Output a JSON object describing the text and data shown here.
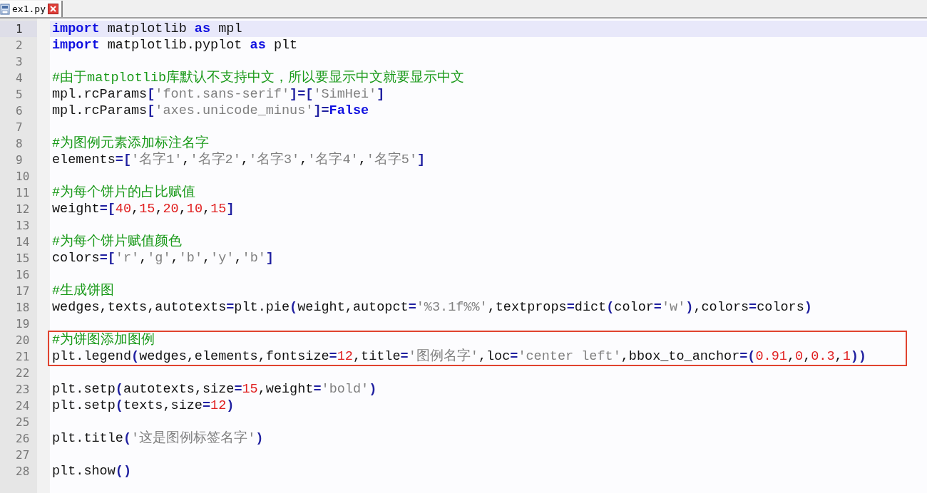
{
  "tabs": [
    {
      "label": "ex1.py",
      "selected": true
    }
  ],
  "lines": [
    {
      "kind": "line",
      "number": "1",
      "current": true,
      "tokens": [
        {
          "kind": "kw",
          "text": "import"
        },
        {
          "kind": "id",
          "text": " matplotlib "
        },
        {
          "kind": "kw",
          "text": "as"
        },
        {
          "kind": "id",
          "text": " mpl"
        }
      ]
    },
    {
      "kind": "line",
      "number": "2",
      "current": false,
      "tokens": [
        {
          "kind": "kw",
          "text": "import"
        },
        {
          "kind": "id",
          "text": " matplotlib.pyplot "
        },
        {
          "kind": "kw",
          "text": "as"
        },
        {
          "kind": "id",
          "text": " plt"
        }
      ]
    },
    {
      "kind": "line",
      "number": "3",
      "current": false
    },
    {
      "kind": "line",
      "number": "4",
      "current": false,
      "tokens": [
        {
          "kind": "com",
          "text": "#由于matplotlib库默认不支持中文，所以要显示中文就要显示中文"
        }
      ]
    },
    {
      "kind": "line",
      "number": "5",
      "current": false,
      "tokens": [
        {
          "kind": "id",
          "text": "mpl.rcParams"
        },
        {
          "kind": "op",
          "text": "["
        },
        {
          "kind": "str",
          "text": "'font.sans-serif'"
        },
        {
          "kind": "op",
          "text": "]=["
        },
        {
          "kind": "str",
          "text": "'SimHei'"
        },
        {
          "kind": "op",
          "text": "]"
        }
      ]
    },
    {
      "kind": "line",
      "number": "6",
      "current": false,
      "tokens": [
        {
          "kind": "id",
          "text": "mpl.rcParams"
        },
        {
          "kind": "op",
          "text": "["
        },
        {
          "kind": "str",
          "text": "'axes.unicode_minus'"
        },
        {
          "kind": "op",
          "text": "]="
        },
        {
          "kind": "kw",
          "text": "False"
        }
      ]
    },
    {
      "kind": "line",
      "number": "7",
      "current": false
    },
    {
      "kind": "line",
      "number": "8",
      "current": false,
      "tokens": [
        {
          "kind": "com",
          "text": "#为图例元素添加标注名字"
        }
      ]
    },
    {
      "kind": "line",
      "number": "9",
      "current": false,
      "tokens": [
        {
          "kind": "id",
          "text": "elements"
        },
        {
          "kind": "op",
          "text": "=["
        },
        {
          "kind": "str",
          "text": "'名字1'"
        },
        {
          "kind": "id",
          "text": ","
        },
        {
          "kind": "str",
          "text": "'名字2'"
        },
        {
          "kind": "id",
          "text": ","
        },
        {
          "kind": "str",
          "text": "'名字3'"
        },
        {
          "kind": "id",
          "text": ","
        },
        {
          "kind": "str",
          "text": "'名字4'"
        },
        {
          "kind": "id",
          "text": ","
        },
        {
          "kind": "str",
          "text": "'名字5'"
        },
        {
          "kind": "op",
          "text": "]"
        }
      ]
    },
    {
      "kind": "line",
      "number": "10",
      "current": false
    },
    {
      "kind": "line",
      "number": "11",
      "current": false,
      "tokens": [
        {
          "kind": "com",
          "text": "#为每个饼片的占比赋值"
        }
      ]
    },
    {
      "kind": "line",
      "number": "12",
      "current": false,
      "tokens": [
        {
          "kind": "id",
          "text": "weight"
        },
        {
          "kind": "op",
          "text": "=["
        },
        {
          "kind": "num",
          "text": "40"
        },
        {
          "kind": "id",
          "text": ","
        },
        {
          "kind": "num",
          "text": "15"
        },
        {
          "kind": "id",
          "text": ","
        },
        {
          "kind": "num",
          "text": "20"
        },
        {
          "kind": "id",
          "text": ","
        },
        {
          "kind": "num",
          "text": "10"
        },
        {
          "kind": "id",
          "text": ","
        },
        {
          "kind": "num",
          "text": "15"
        },
        {
          "kind": "op",
          "text": "]"
        }
      ]
    },
    {
      "kind": "line",
      "number": "13",
      "current": false
    },
    {
      "kind": "line",
      "number": "14",
      "current": false,
      "tokens": [
        {
          "kind": "com",
          "text": "#为每个饼片赋值颜色"
        }
      ]
    },
    {
      "kind": "line",
      "number": "15",
      "current": false,
      "tokens": [
        {
          "kind": "id",
          "text": "colors"
        },
        {
          "kind": "op",
          "text": "=["
        },
        {
          "kind": "str",
          "text": "'r'"
        },
        {
          "kind": "id",
          "text": ","
        },
        {
          "kind": "str",
          "text": "'g'"
        },
        {
          "kind": "id",
          "text": ","
        },
        {
          "kind": "str",
          "text": "'b'"
        },
        {
          "kind": "id",
          "text": ","
        },
        {
          "kind": "str",
          "text": "'y'"
        },
        {
          "kind": "id",
          "text": ","
        },
        {
          "kind": "str",
          "text": "'b'"
        },
        {
          "kind": "op",
          "text": "]"
        }
      ]
    },
    {
      "kind": "line",
      "number": "16",
      "current": false
    },
    {
      "kind": "line",
      "number": "17",
      "current": false,
      "tokens": [
        {
          "kind": "com",
          "text": "#生成饼图"
        }
      ]
    },
    {
      "kind": "line",
      "number": "18",
      "current": false,
      "tokens": [
        {
          "kind": "id",
          "text": "wedges,texts,autotexts"
        },
        {
          "kind": "op",
          "text": "="
        },
        {
          "kind": "id",
          "text": "plt.pie"
        },
        {
          "kind": "op",
          "text": "("
        },
        {
          "kind": "id",
          "text": "weight,autopct"
        },
        {
          "kind": "op",
          "text": "="
        },
        {
          "kind": "str",
          "text": "'%3.1f%%'"
        },
        {
          "kind": "id",
          "text": ",textprops"
        },
        {
          "kind": "op",
          "text": "="
        },
        {
          "kind": "id",
          "text": "dict"
        },
        {
          "kind": "op",
          "text": "("
        },
        {
          "kind": "id",
          "text": "color"
        },
        {
          "kind": "op",
          "text": "="
        },
        {
          "kind": "str",
          "text": "'w'"
        },
        {
          "kind": "op",
          "text": ")"
        },
        {
          "kind": "id",
          "text": ",colors"
        },
        {
          "kind": "op",
          "text": "="
        },
        {
          "kind": "id",
          "text": "colors"
        },
        {
          "kind": "op",
          "text": ")"
        }
      ]
    },
    {
      "kind": "line",
      "number": "19",
      "current": false
    },
    {
      "kind": "frame",
      "lines": [
        {
          "kind": "line",
          "number": "20",
          "current": false,
          "tokens": [
            {
              "kind": "com",
              "text": "#为饼图添加图例"
            }
          ]
        },
        {
          "kind": "line",
          "number": "21",
          "current": false,
          "tokens": [
            {
              "kind": "id",
              "text": "plt.legend"
            },
            {
              "kind": "op",
              "text": "("
            },
            {
              "kind": "id",
              "text": "wedges,elements,fontsize"
            },
            {
              "kind": "op",
              "text": "="
            },
            {
              "kind": "num",
              "text": "12"
            },
            {
              "kind": "id",
              "text": ",title"
            },
            {
              "kind": "op",
              "text": "="
            },
            {
              "kind": "str",
              "text": "'图例名字'"
            },
            {
              "kind": "id",
              "text": ",loc"
            },
            {
              "kind": "op",
              "text": "="
            },
            {
              "kind": "str",
              "text": "'center left'"
            },
            {
              "kind": "id",
              "text": ",bbox_to_anchor"
            },
            {
              "kind": "op",
              "text": "=("
            },
            {
              "kind": "num",
              "text": "0.91"
            },
            {
              "kind": "id",
              "text": ","
            },
            {
              "kind": "num",
              "text": "0"
            },
            {
              "kind": "id",
              "text": ","
            },
            {
              "kind": "num",
              "text": "0.3"
            },
            {
              "kind": "id",
              "text": ","
            },
            {
              "kind": "num",
              "text": "1"
            },
            {
              "kind": "op",
              "text": "))"
            }
          ]
        }
      ]
    },
    {
      "kind": "line",
      "number": "22",
      "current": false
    },
    {
      "kind": "line",
      "number": "23",
      "current": false,
      "tokens": [
        {
          "kind": "id",
          "text": "plt.setp"
        },
        {
          "kind": "op",
          "text": "("
        },
        {
          "kind": "id",
          "text": "autotexts,size"
        },
        {
          "kind": "op",
          "text": "="
        },
        {
          "kind": "num",
          "text": "15"
        },
        {
          "kind": "id",
          "text": ",weight"
        },
        {
          "kind": "op",
          "text": "="
        },
        {
          "kind": "str",
          "text": "'bold'"
        },
        {
          "kind": "op",
          "text": ")"
        }
      ]
    },
    {
      "kind": "line",
      "number": "24",
      "current": false,
      "tokens": [
        {
          "kind": "id",
          "text": "plt.setp"
        },
        {
          "kind": "op",
          "text": "("
        },
        {
          "kind": "id",
          "text": "texts,size"
        },
        {
          "kind": "op",
          "text": "="
        },
        {
          "kind": "num",
          "text": "12"
        },
        {
          "kind": "op",
          "text": ")"
        }
      ]
    },
    {
      "kind": "line",
      "number": "25",
      "current": false
    },
    {
      "kind": "line",
      "number": "26",
      "current": false,
      "tokens": [
        {
          "kind": "id",
          "text": "plt.title"
        },
        {
          "kind": "op",
          "text": "("
        },
        {
          "kind": "str",
          "text": "'这是图例标签名字'"
        },
        {
          "kind": "op",
          "text": ")"
        }
      ]
    },
    {
      "kind": "line",
      "number": "27",
      "current": false
    },
    {
      "kind": "line",
      "number": "28",
      "current": false,
      "tokens": [
        {
          "kind": "id",
          "text": "plt.show"
        },
        {
          "kind": "op",
          "text": "()"
        }
      ]
    }
  ]
}
